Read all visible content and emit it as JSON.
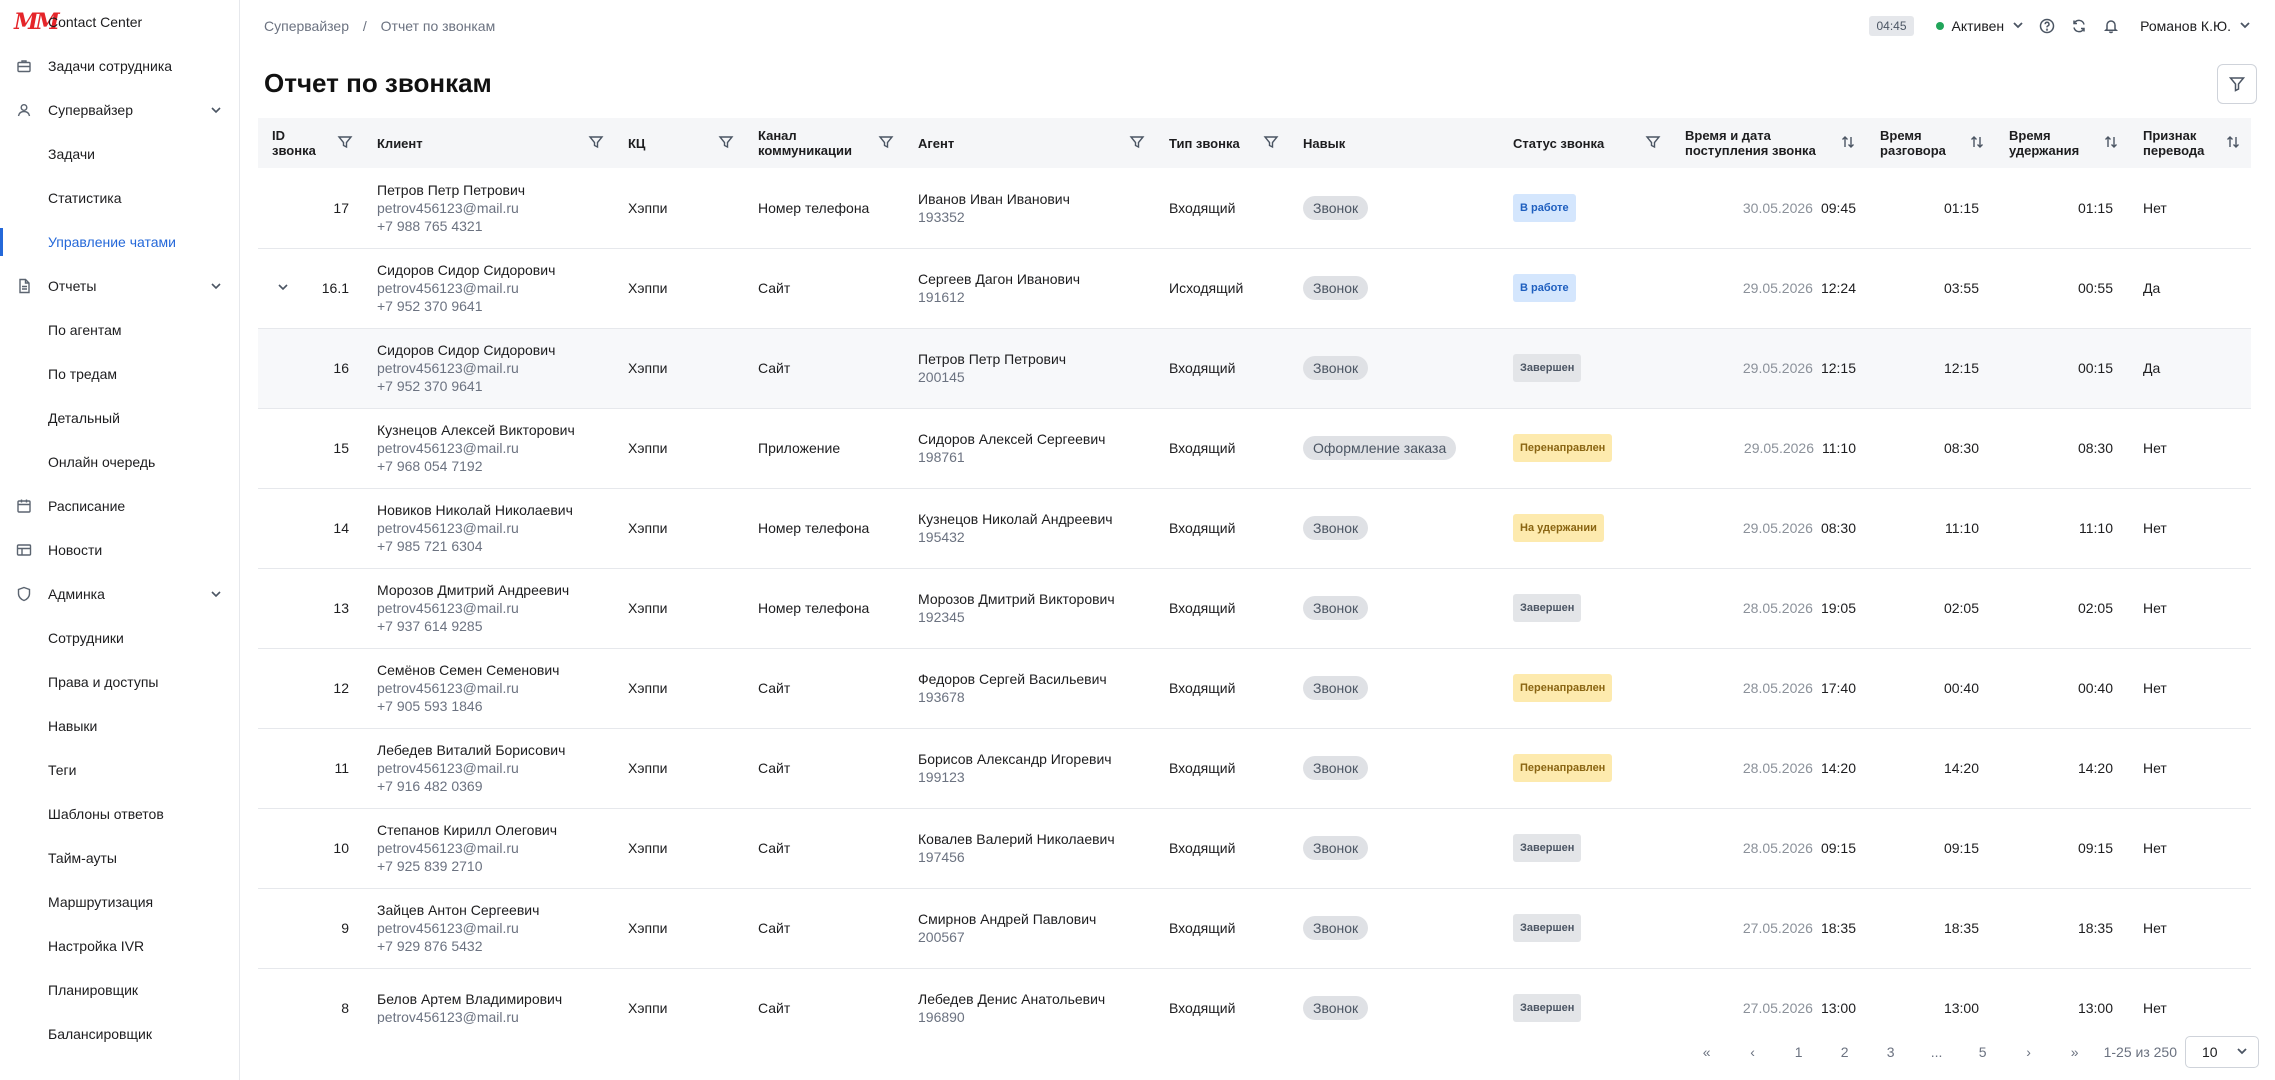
{
  "app": {
    "title": "Contact Center"
  },
  "sidebar": {
    "items": [
      {
        "label": "Задачи сотрудника",
        "icon": "briefcase-icon"
      },
      {
        "label": "Супервайзер",
        "icon": "user-icon",
        "expandable": true
      },
      {
        "label": "Задачи",
        "sub": true
      },
      {
        "label": "Статистика",
        "sub": true
      },
      {
        "label": "Управление чатами",
        "sub": true,
        "active": true
      },
      {
        "label": "Отчеты",
        "icon": "document-icon",
        "expandable": true
      },
      {
        "label": "По агентам",
        "sub": true
      },
      {
        "label": "По тредам",
        "sub": true
      },
      {
        "label": "Детальный",
        "sub": true
      },
      {
        "label": "Онлайн очередь",
        "sub": true
      },
      {
        "label": "Расписание",
        "icon": "calendar-icon"
      },
      {
        "label": "Новости",
        "icon": "news-icon"
      },
      {
        "label": "Админка",
        "icon": "shield-icon",
        "expandable": true
      },
      {
        "label": "Сотрудники",
        "sub": true
      },
      {
        "label": "Права и доступы",
        "sub": true
      },
      {
        "label": "Навыки",
        "sub": true
      },
      {
        "label": "Теги",
        "sub": true
      },
      {
        "label": "Шаблоны ответов",
        "sub": true
      },
      {
        "label": "Тайм-ауты",
        "sub": true
      },
      {
        "label": "Маршрутизация",
        "sub": true
      },
      {
        "label": "Настройка IVR",
        "sub": true
      },
      {
        "label": "Планировщик",
        "sub": true
      },
      {
        "label": "Балансировщик",
        "sub": true
      }
    ]
  },
  "breadcrumb": {
    "parent": "Супервайзер",
    "sep": "/",
    "current": "Отчет по звонкам"
  },
  "header": {
    "timer": "04:45",
    "status": "Активен",
    "user": "Романов К.Ю."
  },
  "page": {
    "title": "Отчет по звонкам"
  },
  "table": {
    "columns": {
      "id": "ID звонка",
      "client": "Клиент",
      "kc": "КЦ",
      "channel": "Канал коммуникации",
      "agent": "Агент",
      "type": "Тип звонка",
      "skill": "Навык",
      "status": "Статус звонка",
      "datetime": "Время и дата поступления звонка",
      "talk": "Время разговора",
      "hold": "Время удержания",
      "transfer": "Признак перевода"
    },
    "rows": [
      {
        "id": "17",
        "client_name": "Петров Петр Петрович",
        "email": "petrov456123@mail.ru",
        "phone": "+7 988 765 4321",
        "kc": "Хэппи",
        "channel": "Номер телефона",
        "agent": "Иванов Иван Иванович",
        "agent_id": "193352",
        "type": "Входящий",
        "skill": "Звонок",
        "status": "В работе",
        "status_kind": "work",
        "date": "30.05.2026",
        "time": "09:45",
        "talk": "01:15",
        "hold": "01:15",
        "transfer": "Нет"
      },
      {
        "id": "16.1",
        "expand": true,
        "client_name": "Сидоров Сидор Сидорович",
        "email": "petrov456123@mail.ru",
        "phone": "+7 952 370 9641",
        "kc": "Хэппи",
        "channel": "Сайт",
        "agent": "Сергеев Дагон Иванович",
        "agent_id": "191612",
        "type": "Исходящий",
        "skill": "Звонок",
        "status": "В работе",
        "status_kind": "work",
        "date": "29.05.2026",
        "time": "12:24",
        "talk": "03:55",
        "hold": "00:55",
        "transfer": "Да"
      },
      {
        "id": "16",
        "shaded": true,
        "client_name": "Сидоров Сидор Сидорович",
        "email": "petrov456123@mail.ru",
        "phone": "+7 952 370 9641",
        "kc": "Хэппи",
        "channel": "Сайт",
        "agent": "Петров Петр Петрович",
        "agent_id": "200145",
        "type": "Входящий",
        "skill": "Звонок",
        "status": "Завершен",
        "status_kind": "done",
        "date": "29.05.2026",
        "time": "12:15",
        "talk": "12:15",
        "hold": "00:15",
        "transfer": "Да"
      },
      {
        "id": "15",
        "client_name": "Кузнецов Алексей Викторович",
        "email": "petrov456123@mail.ru",
        "phone": "+7 968 054 7192",
        "kc": "Хэппи",
        "channel": "Приложение",
        "agent": "Сидоров Алексей Сергеевич",
        "agent_id": "198761",
        "type": "Входящий",
        "skill": "Оформление заказа",
        "status": "Перенаправлен",
        "status_kind": "redir",
        "date": "29.05.2026",
        "time": "11:10",
        "talk": "08:30",
        "hold": "08:30",
        "transfer": "Нет"
      },
      {
        "id": "14",
        "client_name": "Новиков Николай Николаевич",
        "email": "petrov456123@mail.ru",
        "phone": "+7 985 721 6304",
        "kc": "Хэппи",
        "channel": "Номер телефона",
        "agent": "Кузнецов Николай Андреевич",
        "agent_id": "195432",
        "type": "Входящий",
        "skill": "Звонок",
        "status": "На удержании",
        "status_kind": "hold",
        "date": "29.05.2026",
        "time": "08:30",
        "talk": "11:10",
        "hold": "11:10",
        "transfer": "Нет"
      },
      {
        "id": "13",
        "client_name": "Морозов Дмитрий Андреевич",
        "email": "petrov456123@mail.ru",
        "phone": "+7 937 614 9285",
        "kc": "Хэппи",
        "channel": "Номер телефона",
        "agent": "Морозов Дмитрий Викторович",
        "agent_id": "192345",
        "type": "Входящий",
        "skill": "Звонок",
        "status": "Завершен",
        "status_kind": "done",
        "date": "28.05.2026",
        "time": "19:05",
        "talk": "02:05",
        "hold": "02:05",
        "transfer": "Нет"
      },
      {
        "id": "12",
        "client_name": "Семёнов Семен Семенович",
        "email": "petrov456123@mail.ru",
        "phone": "+7 905 593 1846",
        "kc": "Хэппи",
        "channel": "Сайт",
        "agent": "Федоров Сергей Васильевич",
        "agent_id": "193678",
        "type": "Входящий",
        "skill": "Звонок",
        "status": "Перенаправлен",
        "status_kind": "redir",
        "date": "28.05.2026",
        "time": "17:40",
        "talk": "00:40",
        "hold": "00:40",
        "transfer": "Нет"
      },
      {
        "id": "11",
        "client_name": "Лебедев Виталий Борисович",
        "email": "petrov456123@mail.ru",
        "phone": "+7 916 482 0369",
        "kc": "Хэппи",
        "channel": "Сайт",
        "agent": "Борисов Александр Игоревич",
        "agent_id": "199123",
        "type": "Входящий",
        "skill": "Звонок",
        "status": "Перенаправлен",
        "status_kind": "redir",
        "date": "28.05.2026",
        "time": "14:20",
        "talk": "14:20",
        "hold": "14:20",
        "transfer": "Нет"
      },
      {
        "id": "10",
        "client_name": "Степанов Кирилл Олегович",
        "email": "petrov456123@mail.ru",
        "phone": "+7 925 839 2710",
        "kc": "Хэппи",
        "channel": "Сайт",
        "agent": "Ковалев Валерий Николаевич",
        "agent_id": "197456",
        "type": "Входящий",
        "skill": "Звонок",
        "status": "Завершен",
        "status_kind": "done",
        "date": "28.05.2026",
        "time": "09:15",
        "talk": "09:15",
        "hold": "09:15",
        "transfer": "Нет"
      },
      {
        "id": "9",
        "client_name": "Зайцев Антон Сергеевич",
        "email": "petrov456123@mail.ru",
        "phone": "+7 929 876 5432",
        "kc": "Хэппи",
        "channel": "Сайт",
        "agent": "Смирнов Андрей Павлович",
        "agent_id": "200567",
        "type": "Входящий",
        "skill": "Звонок",
        "status": "Завершен",
        "status_kind": "done",
        "date": "27.05.2026",
        "time": "18:35",
        "talk": "18:35",
        "hold": "18:35",
        "transfer": "Нет"
      },
      {
        "id": "8",
        "client_name": "Белов Артем Владимирович",
        "email": "petrov456123@mail.ru",
        "phone": "",
        "kc": "Хэппи",
        "channel": "Сайт",
        "agent": "Лебедев Денис Анатольевич",
        "agent_id": "196890",
        "type": "Входящий",
        "skill": "Звонок",
        "status": "Завершен",
        "status_kind": "done",
        "date": "27.05.2026",
        "time": "13:00",
        "talk": "13:00",
        "hold": "13:00",
        "transfer": "Нет"
      }
    ]
  },
  "pagination": {
    "first": "«",
    "prev": "‹",
    "pages": [
      "1",
      "2",
      "3",
      "...",
      "5"
    ],
    "next": "›",
    "last": "»",
    "info": "1-25 из 250",
    "page_size": "10"
  },
  "colors": {
    "accent": "#2468d9",
    "brand": "#e5252a",
    "online": "#21a55a"
  }
}
